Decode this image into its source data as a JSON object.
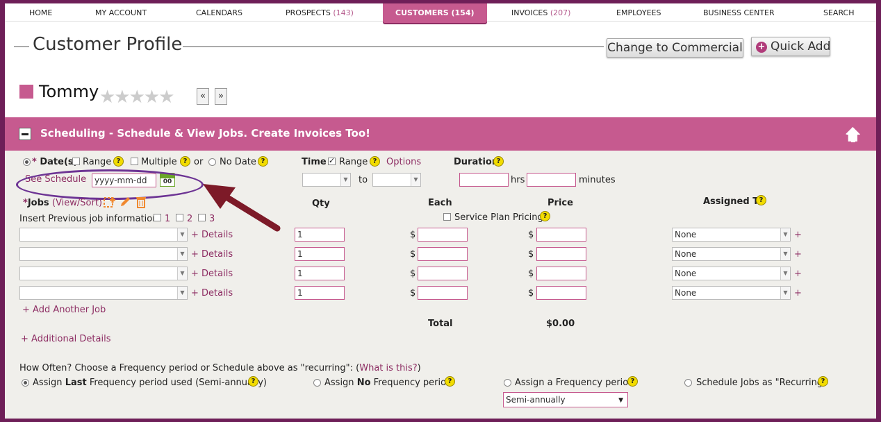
{
  "nav": {
    "home": "HOME",
    "my_account": "MY ACCOUNT",
    "calendars": "CALENDARS",
    "prospects": "PROSPECTS",
    "prospects_count": "(143)",
    "customers": "CUSTOMERS",
    "customers_count": "(154)",
    "invoices": "INVOICES",
    "invoices_count": "(207)",
    "employees": "EMPLOYEES",
    "business_center": "BUSINESS CENTER",
    "search": "SEARCH"
  },
  "header": {
    "title": "Customer Profile",
    "change_button": "Change to Commercial",
    "quick_add_button": "Quick Add",
    "customer_name": "Tommy",
    "stars": "★★★★★",
    "prev": "«",
    "next": "»"
  },
  "panel": {
    "title": "Scheduling - Schedule & View Jobs. Create Invoices Too!",
    "dates_label": "Date(s)",
    "required_mark": "*",
    "range_label": "Range",
    "multiple_label": "Multiple",
    "or_label": "or",
    "no_date_label": "No Date",
    "see_schedule": "See Schedule",
    "date_placeholder": "yyyy-mm-dd",
    "calendar_day": "00",
    "time_label": "Time",
    "time_range_label": "Range",
    "options_link": "Options",
    "to_label": "to",
    "duration_label": "Duration",
    "hrs_label": "hrs",
    "minutes_label": "minutes"
  },
  "jobs": {
    "label": "Jobs",
    "view_sort": "(View/Sort)",
    "insert_prev": "Insert Previous job information",
    "prev_options": [
      "1",
      "2",
      "3"
    ],
    "col_qty": "Qty",
    "col_each": "Each",
    "col_price": "Price",
    "col_assigned": "Assigned To",
    "service_plan": "Service Plan Pricing",
    "details_link": "+ Details",
    "currency": "$",
    "rows": [
      {
        "qty": "1",
        "assigned": "None"
      },
      {
        "qty": "1",
        "assigned": "None"
      },
      {
        "qty": "1",
        "assigned": "None"
      },
      {
        "qty": "1",
        "assigned": "None"
      }
    ],
    "add_plus": "+",
    "add_another": "+ Add Another Job",
    "total_label": "Total",
    "total_value": "$0.00",
    "additional_details": "+ Additional Details"
  },
  "frequency": {
    "question": "How Often? Choose a Frequency period or Schedule above as \"recurring\": (",
    "what_is_this": "What is this?",
    "question_end": ")",
    "opt1_a": "Assign ",
    "opt1_b": "Last",
    "opt1_c": " Frequency period used (Semi-annually)",
    "opt2_a": "Assign ",
    "opt2_b": "No",
    "opt2_c": " Frequency period",
    "opt3": "Assign a Frequency period",
    "opt4": "Schedule Jobs as \"Recurring\"",
    "select_value": "Semi-annually"
  },
  "help_glyph": "?",
  "colors": {
    "accent": "#c65a8f",
    "frame": "#6e1f58",
    "annotation": "#6d3494",
    "arrow": "#7d1a28"
  }
}
